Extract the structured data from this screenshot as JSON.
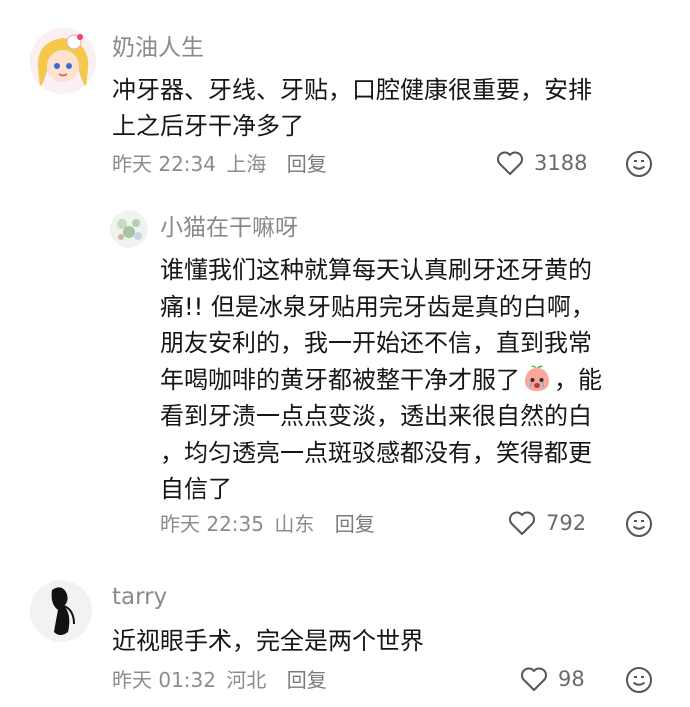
{
  "comments": [
    {
      "username": "奶油人生",
      "line1": "冲牙器、牙线、牙贴，口腔健康很重要，安排",
      "line2": "上之后牙干净多了",
      "time": "昨天 22:34",
      "location": "上海",
      "reply_label": "回复",
      "likes": "3188"
    },
    {
      "username": "小猫在干嘛呀",
      "lines": [
        "谁懂我们这种就算每天认真刷牙还牙黄的",
        "痛!! 但是冰泉牙贴用完牙齿是真的白啊，",
        "朋友安利的，我一开始还不信，直到我常"
      ],
      "line4_before": "年喝咖啡的黄牙都被整干净才服了",
      "line4_after": "，能",
      "lines_tail": [
        "看到牙渍一点点变淡，透出来很自然的白",
        "，均匀透亮一点斑驳感都没有，笑得都更",
        "自信了"
      ],
      "time": "昨天 22:35",
      "location": "山东",
      "reply_label": "回复",
      "likes": "792"
    },
    {
      "username": "tarry",
      "text": "近视眼手术，完全是两个世界",
      "time": "昨天 01:32",
      "location": "河北",
      "reply_label": "回复",
      "likes": "98"
    }
  ],
  "icons": {
    "like": "heart-outline-icon",
    "emoji": "smiley-face-icon",
    "inline": "crying-peach-emoji"
  },
  "colors": {
    "username": "#8a8a8a",
    "meta": "#8c8c8c",
    "text": "#161616"
  }
}
